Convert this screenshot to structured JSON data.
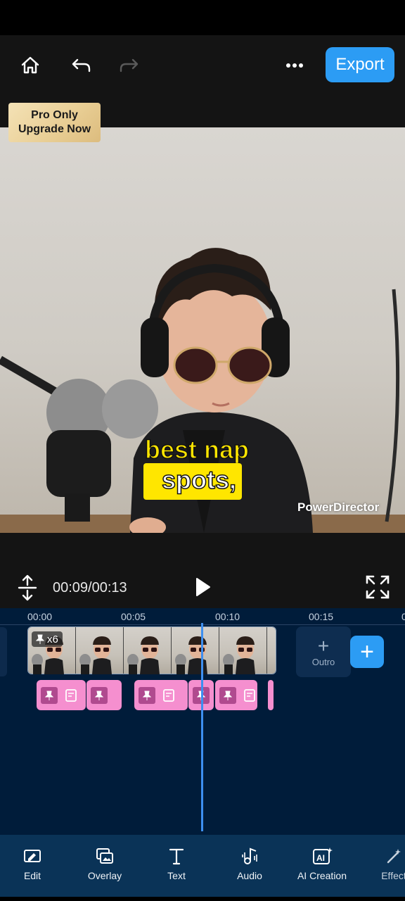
{
  "toolbar": {
    "export_label": "Export",
    "accent_color": "#2c9cf4"
  },
  "pro_badge": {
    "line1": "Pro Only",
    "line2": "Upgrade Now"
  },
  "preview": {
    "caption_line1": "best nap",
    "caption_line2": "spots,",
    "watermark": "PowerDirector",
    "caption_color": "#ffe600"
  },
  "playback": {
    "time": "00:09/00:13"
  },
  "timeline": {
    "ticks": [
      "00:00",
      "00:05",
      "00:10",
      "00:15"
    ],
    "speed_label": "x6",
    "outro_label": "Outro",
    "outro_plus": "+",
    "add_plus": "+",
    "playhead_time": "00:09",
    "track_color": "#001c3a",
    "sticker_color": "#f58fcf"
  },
  "bottom_tools": [
    {
      "label": "Edit",
      "icon": "edit-icon"
    },
    {
      "label": "Overlay",
      "icon": "overlay-icon"
    },
    {
      "label": "Text",
      "icon": "text-icon"
    },
    {
      "label": "Audio",
      "icon": "audio-icon"
    },
    {
      "label": "AI Creation",
      "icon": "ai-creation-icon"
    },
    {
      "label": "Effect",
      "icon": "effect-icon"
    }
  ]
}
